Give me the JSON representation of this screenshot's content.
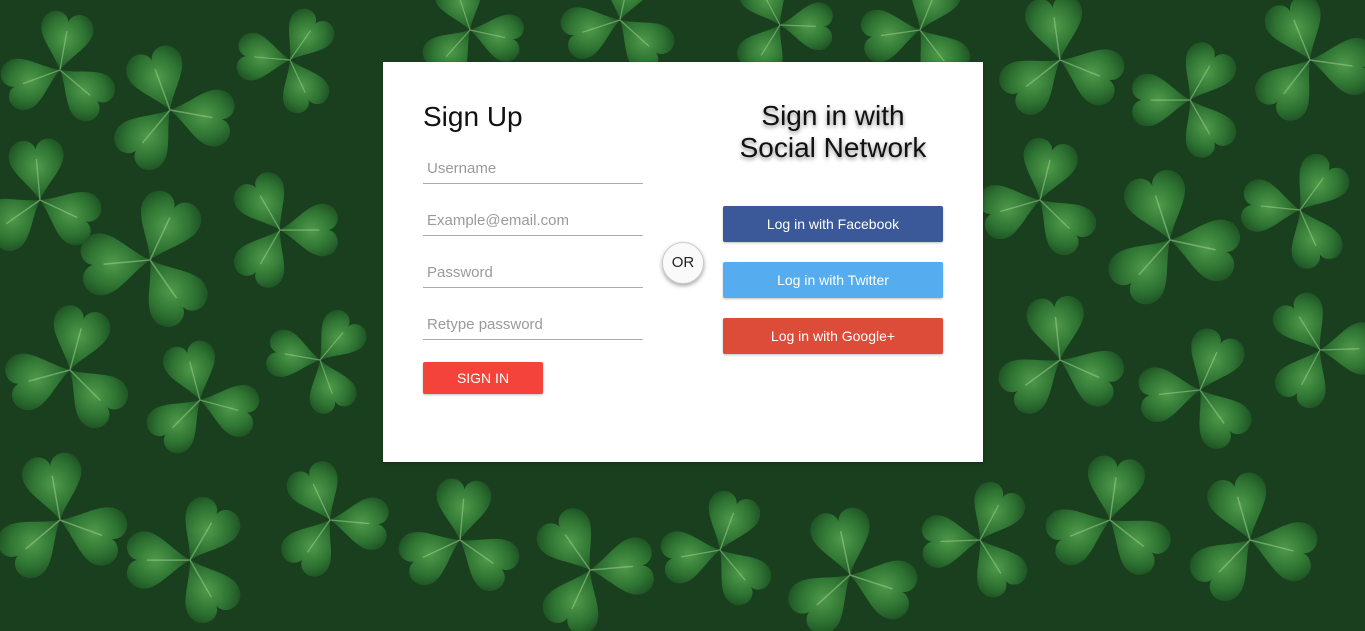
{
  "signup": {
    "title": "Sign Up",
    "username_placeholder": "Username",
    "email_placeholder": "Example@email.com",
    "password_placeholder": "Password",
    "retype_placeholder": "Retype password",
    "submit_label": "SIGN IN"
  },
  "divider": {
    "label": "OR"
  },
  "social": {
    "title_line1": "Sign in with",
    "title_line2": "Social Network",
    "facebook_label": "Log in with Facebook",
    "twitter_label": "Log in with Twitter",
    "google_label": "Log in with Google+"
  },
  "colors": {
    "submit": "#f4433a",
    "facebook": "#3b5998",
    "twitter": "#55acee",
    "google": "#dd4b39",
    "background": "#1f4a26"
  },
  "background": {
    "icon": "clover-leaves-background"
  }
}
